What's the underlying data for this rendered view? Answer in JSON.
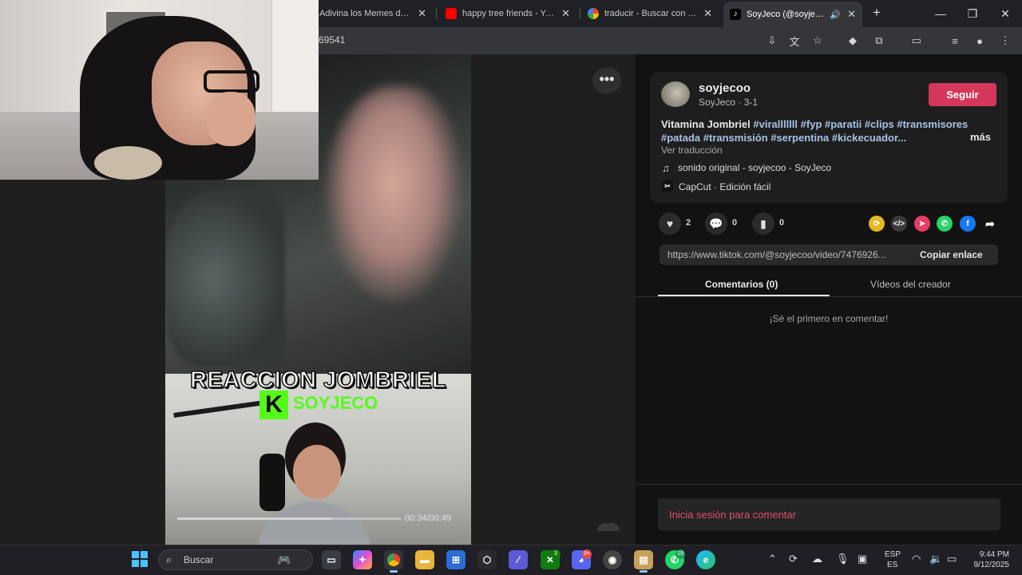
{
  "browser": {
    "tabs": [
      {
        "title": "Adivina los Memes de B"
      },
      {
        "title": "happy tree friends - You"
      },
      {
        "title": "traducir - Buscar con Go"
      },
      {
        "title": "SoyJeco (@soyjecoo"
      }
    ],
    "address_visible": "69541",
    "new_tab": "+",
    "close_symbol": "✕"
  },
  "video": {
    "overlay_title": "REACCION JOMBRIEL",
    "overlay_brand": "SOYJECO",
    "kick_letter": "K",
    "time": "00:34/00:49",
    "progress": 0.69,
    "more_label": "•••"
  },
  "post": {
    "username": "soyjecoo",
    "display_name": "SoyJeco",
    "date": "3-1",
    "follow_label": "Seguir",
    "description_text": "Vitamina Jombriel",
    "hashtags": [
      "#viralllllll",
      "#fyp",
      "#paratii",
      "#clips",
      "#transmisores",
      "#patada",
      "#transmisión",
      "#serpentina",
      "#kickecuador..."
    ],
    "more_label": "más",
    "translate_label": "Ver traducción",
    "sound": "sonido original - soyjecoo - SoyJeco",
    "capcut": "CapCut · Edición fácil",
    "likes": "2",
    "comments": "0",
    "saves": "0",
    "link": "https://www.tiktok.com/@soyjecoo/video/7476926...",
    "copy_label": "Copiar enlace",
    "tab_comments": "Comentarios (0)",
    "tab_videos": "Vídeos del creador",
    "empty_comments": "¡Sé el primero en comentar!",
    "login_prompt": "Inicia sesión para comentar"
  },
  "taskbar": {
    "search_placeholder": "Buscar",
    "lang_top": "ESP",
    "lang_bottom": "ES",
    "time": "9:44 PM",
    "date": "9/12/2025",
    "badges": {
      "xbox": "3",
      "discord": "9+",
      "whatsapp": "19"
    }
  },
  "colors": {
    "accent": "#d4375a",
    "hashtag": "#a9c2e8",
    "kick_green": "#53fc18",
    "login_text": "#e04e6b"
  }
}
